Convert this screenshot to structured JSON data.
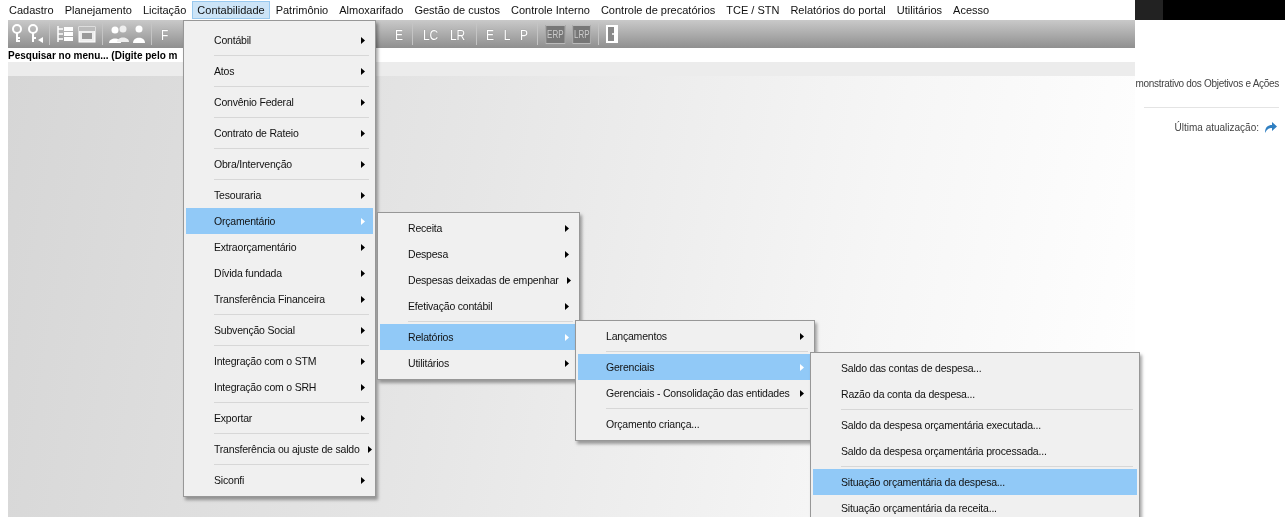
{
  "menubar": [
    {
      "label": "Cadastro",
      "selected": false
    },
    {
      "label": "Planejamento",
      "selected": false
    },
    {
      "label": "Licitação",
      "selected": false
    },
    {
      "label": "Contabilidade",
      "selected": true
    },
    {
      "label": "Patrimônio",
      "selected": false
    },
    {
      "label": "Almoxarifado",
      "selected": false
    },
    {
      "label": "Gestão de custos",
      "selected": false
    },
    {
      "label": "Controle Interno",
      "selected": false
    },
    {
      "label": "Controle de precatórios",
      "selected": false
    },
    {
      "label": "TCE / STN",
      "selected": false
    },
    {
      "label": "Relatórios do portal",
      "selected": false
    },
    {
      "label": "Utilitários",
      "selected": false
    },
    {
      "label": "Acesso",
      "selected": false
    }
  ],
  "toolbar": {
    "left_buttons": [
      {
        "label": "F",
        "disabled": false
      }
    ],
    "right_groups": [
      [
        {
          "label": "E",
          "disabled": false
        }
      ],
      [
        {
          "label": "LC",
          "disabled": false
        },
        {
          "label": "LR",
          "disabled": false
        }
      ],
      [
        {
          "label": "E",
          "disabled": false
        },
        {
          "label": "L",
          "disabled": false
        },
        {
          "label": "P",
          "disabled": false
        }
      ],
      [
        {
          "label": "ERP",
          "disabled": true
        },
        {
          "label": "LRP",
          "disabled": true
        }
      ]
    ]
  },
  "search": {
    "label": "Pesquisar no menu... (Digite pelo m"
  },
  "side_panel": {
    "heading": "monstrativo dos Objetivos e Ações",
    "update_label": "Última atualização:"
  },
  "menus": [
    {
      "groups": [
        [
          {
            "label": "Contábil",
            "selected": false,
            "submenu": true
          }
        ],
        [
          {
            "label": "Atos",
            "selected": false,
            "submenu": true
          }
        ],
        [
          {
            "label": "Convênio Federal",
            "selected": false,
            "submenu": true
          }
        ],
        [
          {
            "label": "Contrato de Rateio",
            "selected": false,
            "submenu": true
          }
        ],
        [
          {
            "label": "Obra/Intervenção",
            "selected": false,
            "submenu": true
          }
        ],
        [
          {
            "label": "Tesouraria",
            "selected": false,
            "submenu": true
          },
          {
            "label": "Orçamentário",
            "selected": true,
            "submenu": true
          },
          {
            "label": "Extraorçamentário",
            "selected": false,
            "submenu": true
          },
          {
            "label": "Dívida fundada",
            "selected": false,
            "submenu": true
          },
          {
            "label": "Transferência Financeira",
            "selected": false,
            "submenu": true
          }
        ],
        [
          {
            "label": "Subvenção Social",
            "selected": false,
            "submenu": true
          }
        ],
        [
          {
            "label": "Integração com o STM",
            "selected": false,
            "submenu": true
          },
          {
            "label": "Integração com o SRH",
            "selected": false,
            "submenu": true
          }
        ],
        [
          {
            "label": "Exportar",
            "selected": false,
            "submenu": true
          }
        ],
        [
          {
            "label": "Transferência ou ajuste de saldo",
            "selected": false,
            "submenu": true
          }
        ],
        [
          {
            "label": "Siconfi",
            "selected": false,
            "submenu": true
          }
        ]
      ]
    },
    {
      "groups": [
        [
          {
            "label": "Receita",
            "selected": false,
            "submenu": true
          },
          {
            "label": "Despesa",
            "selected": false,
            "submenu": true
          },
          {
            "label": "Despesas deixadas de empenhar",
            "selected": false,
            "submenu": true
          },
          {
            "label": "Efetivação contábil",
            "selected": false,
            "submenu": true
          }
        ],
        [
          {
            "label": "Relatórios",
            "selected": true,
            "submenu": true
          },
          {
            "label": "Utilitários",
            "selected": false,
            "submenu": true
          }
        ]
      ]
    },
    {
      "groups": [
        [
          {
            "label": "Lançamentos",
            "selected": false,
            "submenu": true
          }
        ],
        [
          {
            "label": "Gerenciais",
            "selected": true,
            "submenu": true
          },
          {
            "label": "Gerenciais - Consolidação das entidades",
            "selected": false,
            "submenu": true
          }
        ],
        [
          {
            "label": "Orçamento criança...",
            "selected": false,
            "submenu": false
          }
        ]
      ]
    },
    {
      "groups": [
        [
          {
            "label": "Saldo das contas de despesa...",
            "selected": false,
            "submenu": false
          },
          {
            "label": "Razão da conta da despesa...",
            "selected": false,
            "submenu": false
          }
        ],
        [
          {
            "label": "Saldo da despesa orçamentária executada...",
            "selected": false,
            "submenu": false
          },
          {
            "label": "Saldo da despesa orçamentária processada...",
            "selected": false,
            "submenu": false
          }
        ],
        [
          {
            "label": "Situação orçamentária da despesa...",
            "selected": true,
            "submenu": false
          },
          {
            "label": "Situação orçamentária da receita...",
            "selected": false,
            "submenu": false
          }
        ]
      ]
    }
  ]
}
